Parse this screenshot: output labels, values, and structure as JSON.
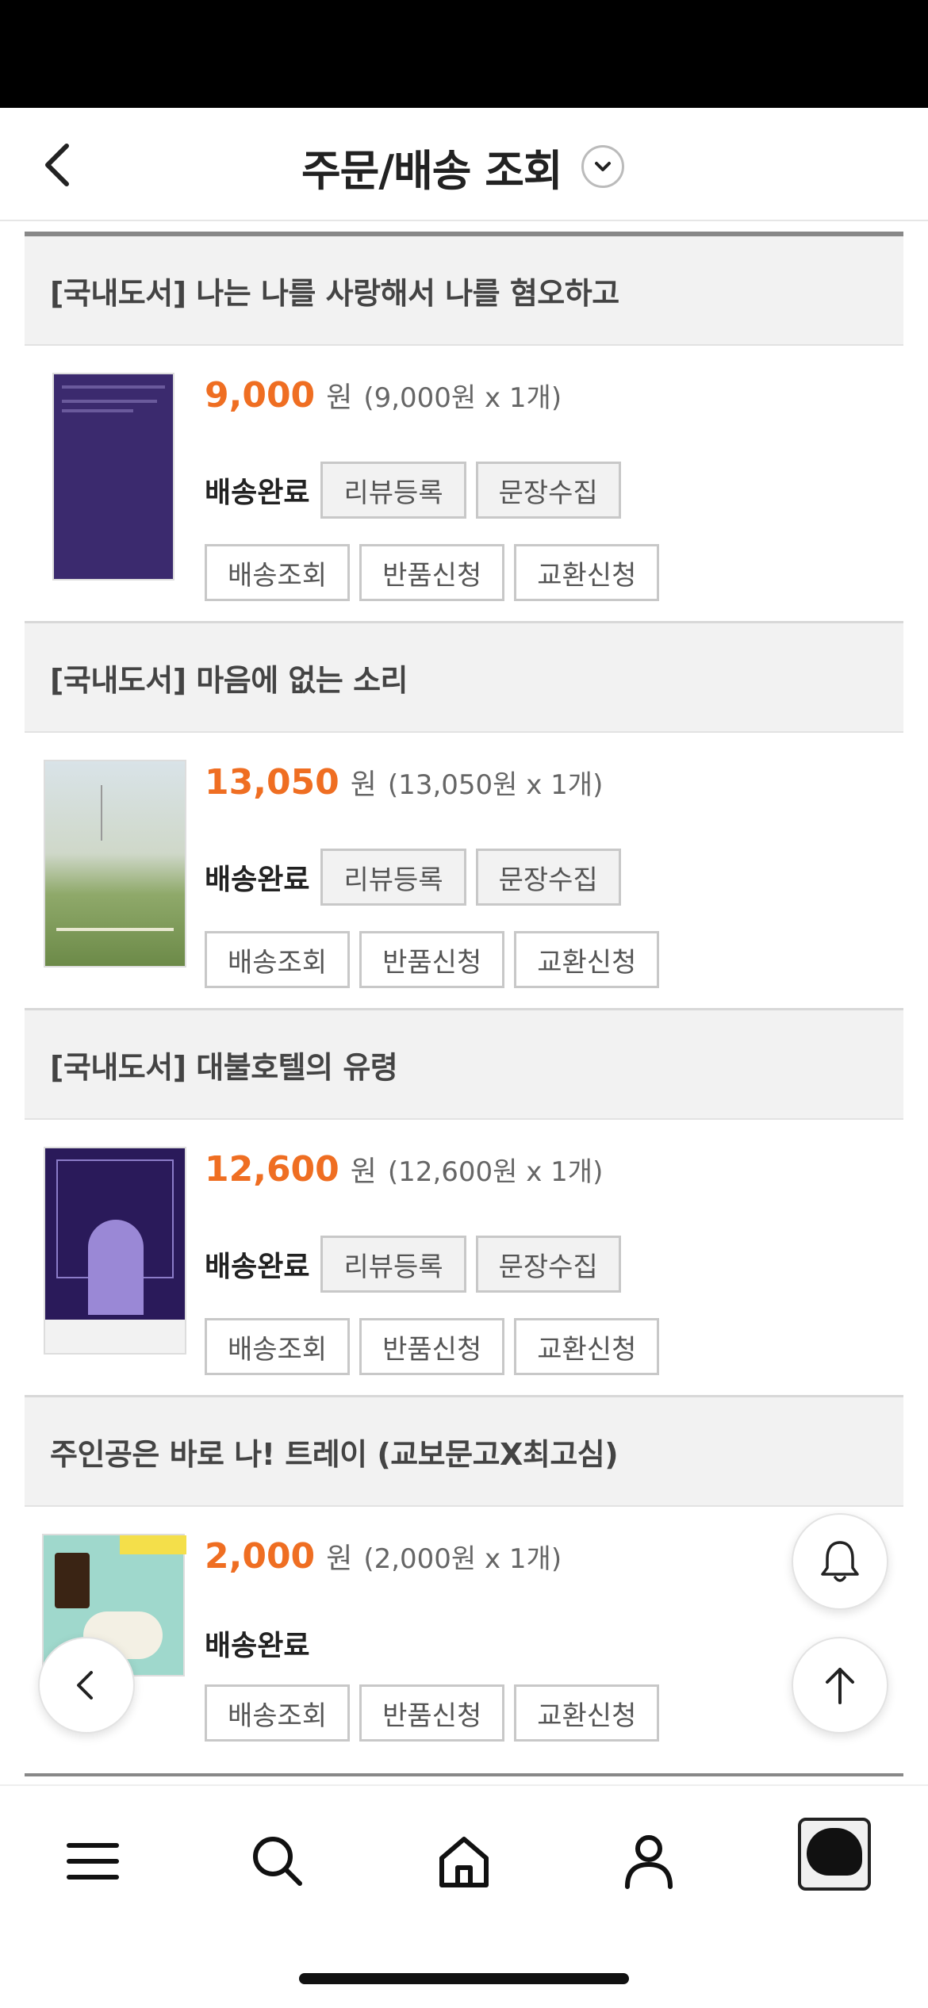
{
  "header": {
    "title": "주문/배송 조회"
  },
  "orders": [
    {
      "title": "[국내도서] 나는 나를 사랑해서 나를 혐오하고",
      "price": "9,000",
      "won": "원",
      "detail": "(9,000원 x 1개)",
      "status": "배송완료",
      "buttons": [
        "리뷰등록",
        "문장수집"
      ],
      "actions": [
        "배송조회",
        "반품신청",
        "교환신청"
      ]
    },
    {
      "title": "[국내도서] 마음에 없는 소리",
      "price": "13,050",
      "won": "원",
      "detail": "(13,050원 x 1개)",
      "status": "배송완료",
      "buttons": [
        "리뷰등록",
        "문장수집"
      ],
      "actions": [
        "배송조회",
        "반품신청",
        "교환신청"
      ]
    },
    {
      "title": "[국내도서] 대불호텔의 유령",
      "price": "12,600",
      "won": "원",
      "detail": "(12,600원 x 1개)",
      "status": "배송완료",
      "buttons": [
        "리뷰등록",
        "문장수집"
      ],
      "actions": [
        "배송조회",
        "반품신청",
        "교환신청"
      ]
    },
    {
      "title": "주인공은 바로 나! 트레이 (교보문고X최고심)",
      "price": "2,000",
      "won": "원",
      "detail": "(2,000원 x 1개)",
      "status": "배송완료",
      "actions": [
        "배송조회",
        "반품신청",
        "교환신청"
      ]
    }
  ],
  "colors": {
    "price": "#ef6e22",
    "book1_cover": "#3b2a6e",
    "book3_cover": "#2a1a5a"
  },
  "icons": {
    "nav_back": "chevron-left-icon",
    "dropdown": "chevron-down-icon",
    "fab_bell": "bell-icon",
    "fab_top": "arrow-up-icon",
    "fab_back": "chevron-left-icon",
    "tabs": [
      "menu-icon",
      "search-icon",
      "home-icon",
      "user-icon",
      "profile-thumbnail"
    ]
  }
}
